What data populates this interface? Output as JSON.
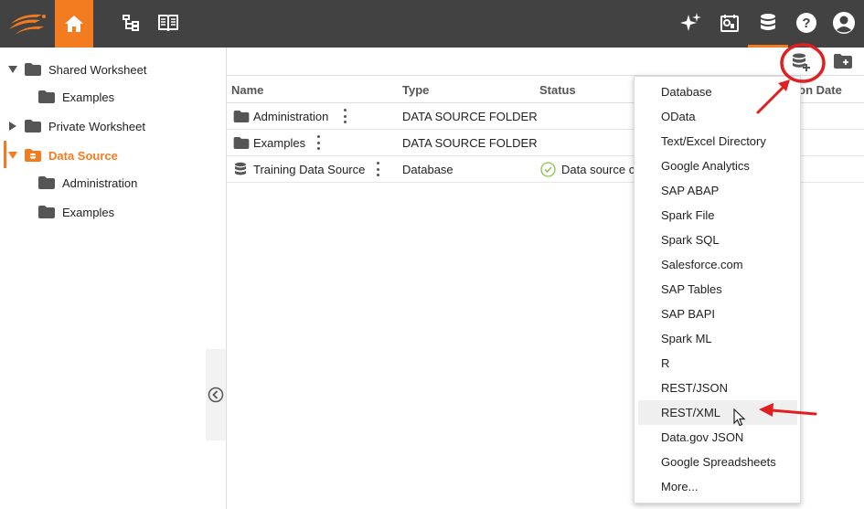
{
  "topbar": {
    "icons": [
      "logo",
      "home-icon",
      "hierarchy-icon",
      "book-icon",
      "sparkle-icon",
      "dashboard-icon",
      "database-icon",
      "help-icon",
      "user-icon"
    ],
    "accent": "#f47c20",
    "bar_color": "#424242"
  },
  "sidebar": {
    "items": [
      {
        "label": "Shared Worksheet",
        "expanded": true
      },
      {
        "label": "Examples"
      },
      {
        "label": "Private Worksheet",
        "expanded": false
      },
      {
        "label": "Data Source",
        "expanded": true,
        "active": true
      },
      {
        "label": "Administration"
      },
      {
        "label": "Examples"
      }
    ]
  },
  "table": {
    "columns": [
      "Name",
      "Type",
      "Status",
      "ation Date"
    ],
    "rows": [
      {
        "name": "Administration",
        "type": "DATA SOURCE FOLDER",
        "status": ""
      },
      {
        "name": "Examples",
        "type": "DATA SOURCE FOLDER",
        "status": ""
      },
      {
        "name": "Training Data Source",
        "type": "Database",
        "status": "Data source c"
      }
    ]
  },
  "menu": {
    "items": [
      "Database",
      "OData",
      "Text/Excel Directory",
      "Google Analytics",
      "SAP ABAP",
      "Spark File",
      "Spark SQL",
      "Salesforce.com",
      "SAP Tables",
      "SAP BAPI",
      "Spark ML",
      "R",
      "REST/JSON",
      "REST/XML",
      "Data.gov JSON",
      "Google Spreadsheets",
      "More..."
    ],
    "hovered": "REST/XML"
  },
  "colors": {
    "annotation": "#e02020",
    "status_ok": "#8bc34a"
  }
}
